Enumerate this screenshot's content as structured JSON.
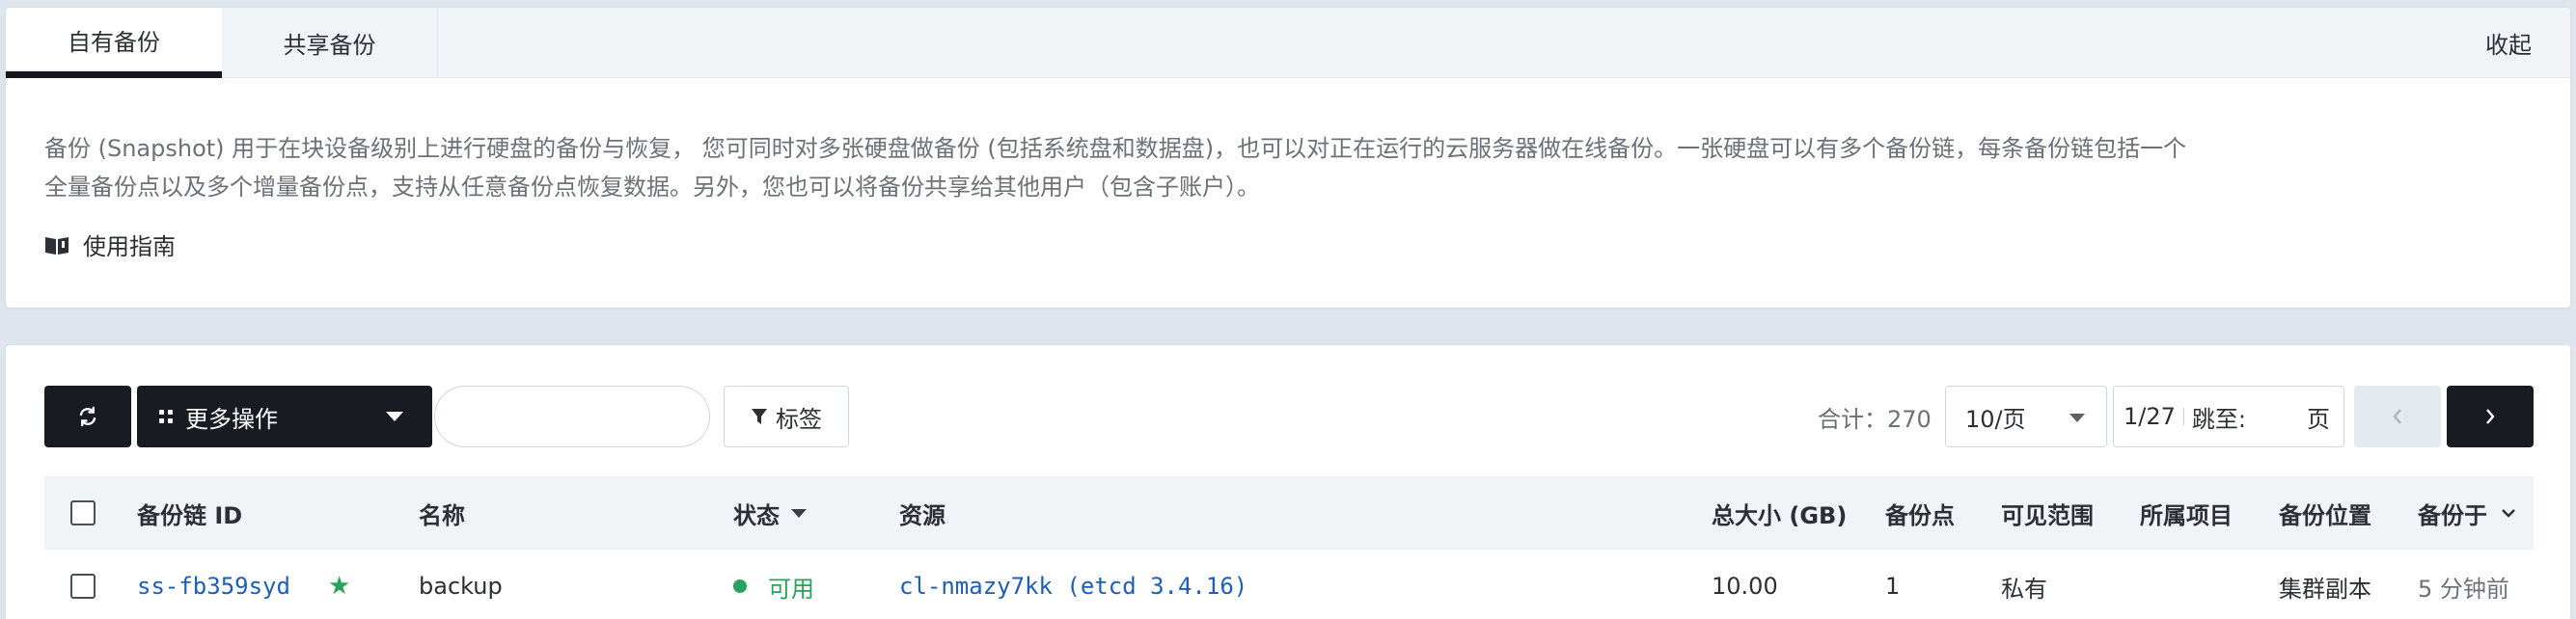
{
  "tabs": [
    {
      "label": "自有备份",
      "active": true
    },
    {
      "label": "共享备份",
      "active": false
    }
  ],
  "collapse_label": "收起",
  "description": {
    "line1": "备份 (Snapshot) 用于在块设备级别上进行硬盘的备份与恢复， 您可同时对多张硬盘做备份 (包括系统盘和数据盘)，也可以对正在运行的云服务器做在线备份。一张硬盘可以有多个备份链，每条备份链包括一个",
    "line2": "全量备份点以及多个增量备份点，支持从任意备份点恢复数据。另外，您也可以将备份共享给其他用户（包含子账户）。"
  },
  "guide_label": "使用指南",
  "toolbar": {
    "more_label": "更多操作",
    "search_value": "",
    "tag_label": "标签"
  },
  "pagination": {
    "total": "合计：270",
    "page_size": "10/页",
    "current": "1/27",
    "jump_label": "跳至:",
    "page_unit": "页"
  },
  "table": {
    "headers": {
      "id": "备份链 ID",
      "name": "名称",
      "status": "状态",
      "resource": "资源",
      "size": "总大小 (GB)",
      "points": "备份点",
      "visibility": "可见范围",
      "project": "所属项目",
      "location": "备份位置",
      "time": "备份于"
    },
    "rows": [
      {
        "id": "ss-fb359syd",
        "name": "backup",
        "status": "可用",
        "resource": "cl-nmazy7kk (etcd 3.4.16)",
        "size": "10.00",
        "points": "1",
        "visibility": "私有",
        "project": "",
        "location": "集群副本",
        "time": "5 分钟前"
      }
    ]
  },
  "colors": {
    "dark": "#181c22",
    "link": "#1c5fb8",
    "success": "#27a35a",
    "muted": "#6c7177"
  }
}
